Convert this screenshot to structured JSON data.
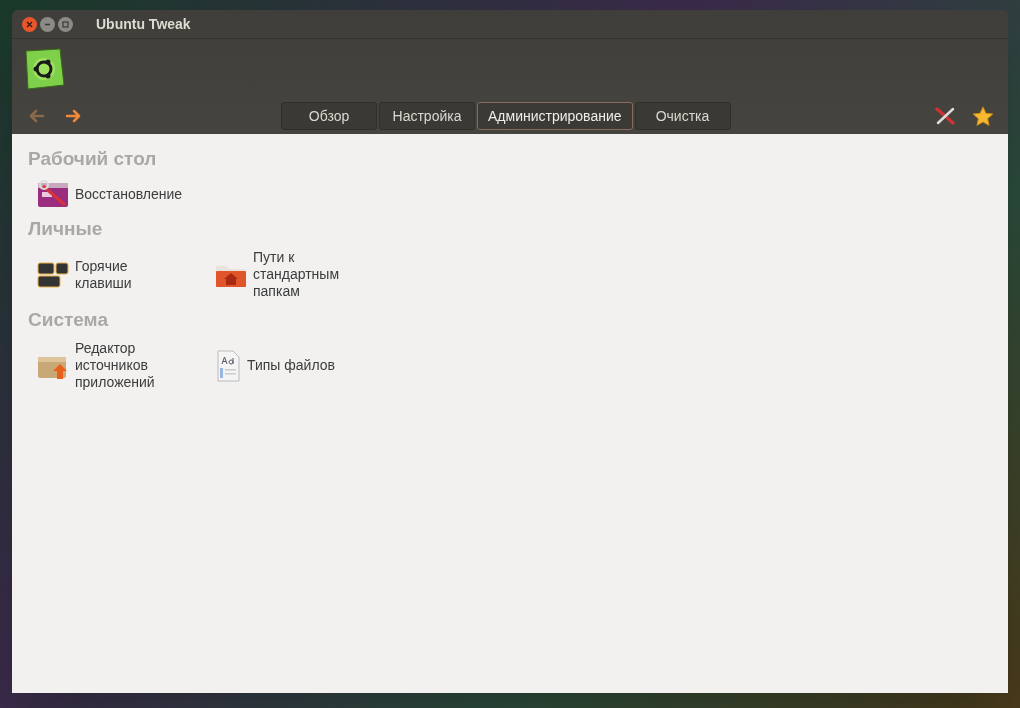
{
  "window": {
    "title": "Ubuntu Tweak"
  },
  "navigation": {
    "back": {
      "disabled": true
    },
    "forward": {
      "disabled": false
    }
  },
  "tabs": [
    {
      "label": "Обзор",
      "selected": false
    },
    {
      "label": "Настройка",
      "selected": false
    },
    {
      "label": "Администрирование",
      "selected": true
    },
    {
      "label": "Очистка",
      "selected": false
    }
  ],
  "sections": [
    {
      "title": "Рабочий стол",
      "items": [
        {
          "kind": "restore",
          "label": "Восстановление"
        }
      ]
    },
    {
      "title": "Личные",
      "items": [
        {
          "kind": "hotkeys",
          "label": "Горячие\nклавиши"
        },
        {
          "kind": "folders",
          "label": "Пути к\nстандартным\nпапкам"
        }
      ]
    },
    {
      "title": "Система",
      "items": [
        {
          "kind": "sources",
          "label": "Редактор\nисточников\nприложений"
        },
        {
          "kind": "filetypes",
          "label": "Типы файлов"
        }
      ]
    }
  ]
}
